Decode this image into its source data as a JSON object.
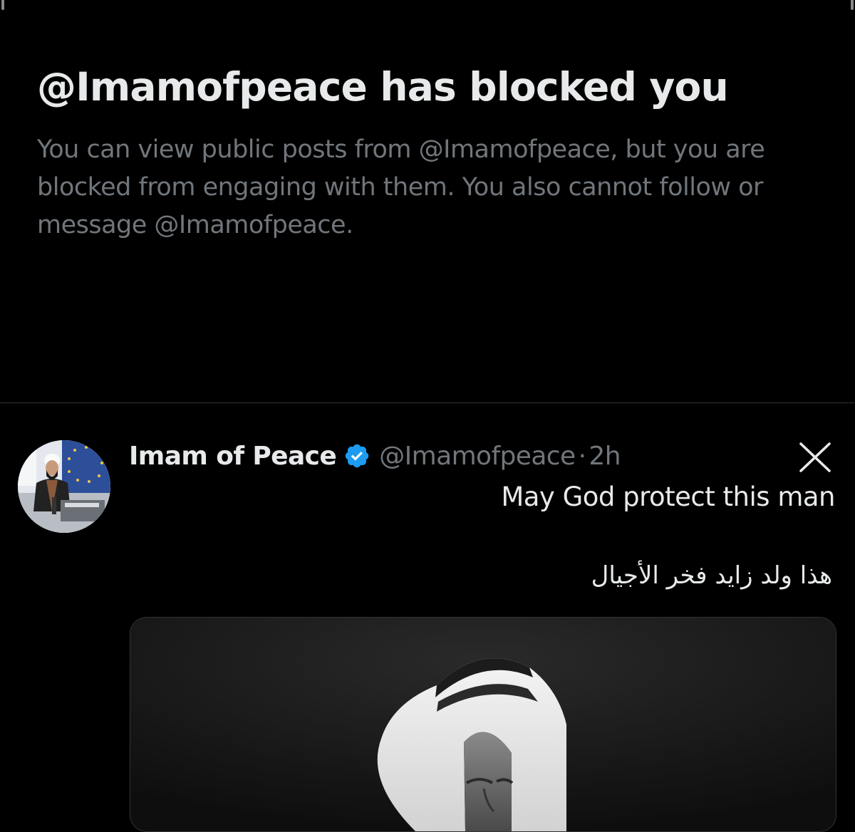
{
  "blocked_notice": {
    "title": "@Imamofpeace has blocked you",
    "description": "You can view public posts from @Imamofpeace, but you are blocked from engaging with them. You also cannot follow or message @Imamofpeace."
  },
  "post": {
    "author": {
      "display_name": "Imam of Peace",
      "verified": true,
      "handle": "@Imamofpeace",
      "avatar_icon": "avatar"
    },
    "separator": "·",
    "time": "2h",
    "text_en": "May God protect this man",
    "text_ar": "هذا ولد زايد فخر الأجيال",
    "media_icon": "photo-of-man-in-white-headdress"
  },
  "colors": {
    "background": "#000000",
    "primary_text": "#e7e9ea",
    "secondary_text": "#71767b",
    "verified_badge": "#1d9bf0",
    "divider": "#2f3336"
  }
}
